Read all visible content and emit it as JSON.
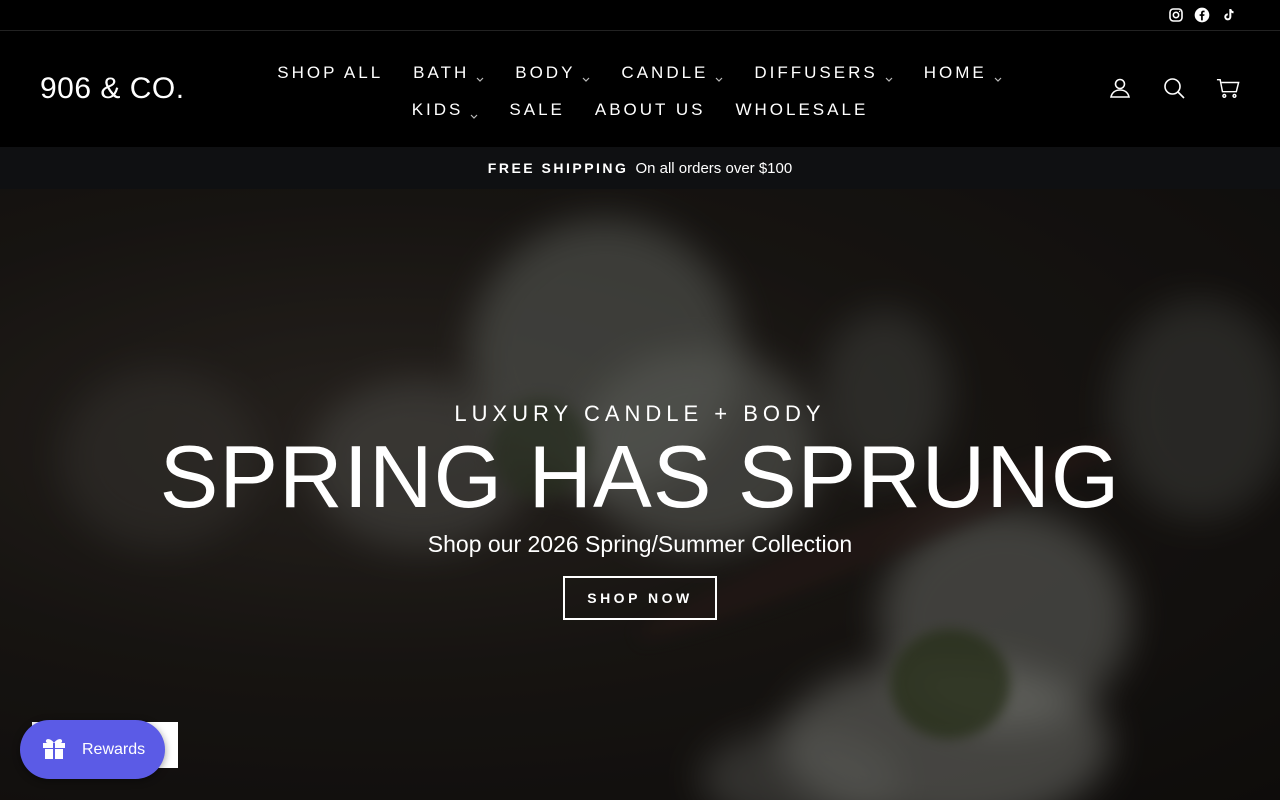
{
  "social": {
    "icons": [
      "instagram-icon",
      "facebook-icon",
      "tiktok-icon"
    ]
  },
  "header": {
    "logo": "906 & CO.",
    "nav_row1": [
      {
        "label": "SHOP ALL",
        "dropdown": false
      },
      {
        "label": "BATH",
        "dropdown": true
      },
      {
        "label": "BODY",
        "dropdown": true
      },
      {
        "label": "CANDLE",
        "dropdown": true
      },
      {
        "label": "DIFFUSERS",
        "dropdown": true
      },
      {
        "label": "HOME",
        "dropdown": true
      }
    ],
    "nav_row2": [
      {
        "label": "KIDS",
        "dropdown": true
      },
      {
        "label": "SALE",
        "dropdown": false
      },
      {
        "label": "ABOUT US",
        "dropdown": false
      },
      {
        "label": "WHOLESALE",
        "dropdown": false
      }
    ],
    "icons": [
      "account-icon",
      "search-icon",
      "cart-icon"
    ]
  },
  "announcement": {
    "strong": "FREE SHIPPING",
    "text": "On all orders over $100"
  },
  "hero": {
    "eyebrow": "LUXURY CANDLE + BODY",
    "headline": "SPRING HAS SPRUNG",
    "subhead": "Shop our 2026 Spring/Summer Collection",
    "cta": "SHOP NOW"
  },
  "rewards": {
    "label": "Rewards",
    "color": "#5b5be6"
  }
}
